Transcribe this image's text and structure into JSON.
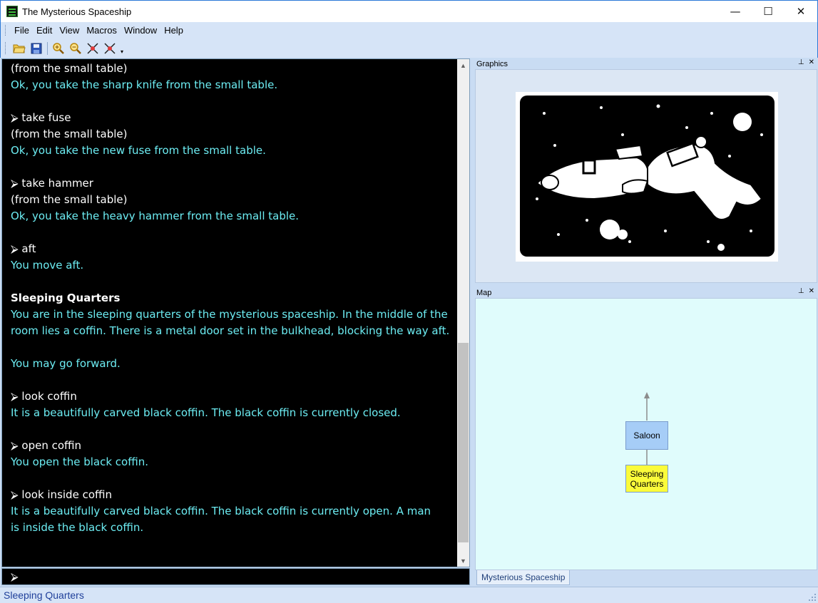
{
  "window": {
    "title": "The Mysterious Spaceship",
    "minimize_glyph": "—",
    "maximize_glyph": "☐",
    "close_glyph": "✕"
  },
  "menu": {
    "items": [
      {
        "label": "File"
      },
      {
        "label": "Edit"
      },
      {
        "label": "View"
      },
      {
        "label": "Macros"
      },
      {
        "label": "Window"
      },
      {
        "label": "Help"
      }
    ]
  },
  "toolbar": {
    "icons": [
      "open-folder-icon",
      "save-disk-icon",
      "zoom-in-icon",
      "zoom-out-icon",
      "restore-icon",
      "stop-icon"
    ],
    "more_glyph": "▾"
  },
  "transcript": {
    "lines": [
      {
        "style": "white",
        "text": "(from the small table)"
      },
      {
        "style": "cyan",
        "text": "Ok, you take the sharp knife from the small table."
      },
      {
        "style": "blank",
        "text": ""
      },
      {
        "style": "white",
        "text": "⮚ take fuse"
      },
      {
        "style": "white",
        "text": "(from the small table)"
      },
      {
        "style": "cyan",
        "text": "Ok, you take the new fuse from the small table."
      },
      {
        "style": "blank",
        "text": ""
      },
      {
        "style": "white",
        "text": "⮚ take hammer"
      },
      {
        "style": "white",
        "text": "(from the small table)"
      },
      {
        "style": "cyan",
        "text": "Ok, you take the heavy hammer from the small table."
      },
      {
        "style": "blank",
        "text": ""
      },
      {
        "style": "white",
        "text": "⮚ aft"
      },
      {
        "style": "cyan",
        "text": "You move aft."
      },
      {
        "style": "blank",
        "text": ""
      },
      {
        "style": "bold",
        "text": "Sleeping Quarters"
      },
      {
        "style": "cyan",
        "text": "You are in the sleeping quarters of the mysterious spaceship. In the middle of the"
      },
      {
        "style": "cyan",
        "text": "room lies a coffin. There is a metal door set in the bulkhead, blocking the way aft."
      },
      {
        "style": "blank",
        "text": ""
      },
      {
        "style": "cyan",
        "text": "You may go forward."
      },
      {
        "style": "blank",
        "text": ""
      },
      {
        "style": "white",
        "text": "⮚ look coffin"
      },
      {
        "style": "cyan",
        "text": "It is a beautifully carved black coffin.  The black coffin is currently closed."
      },
      {
        "style": "blank",
        "text": ""
      },
      {
        "style": "white",
        "text": "⮚ open coffin"
      },
      {
        "style": "cyan",
        "text": "You open the black coffin."
      },
      {
        "style": "blank",
        "text": ""
      },
      {
        "style": "white",
        "text": "⮚ look inside coffin"
      },
      {
        "style": "cyan",
        "text": "It is a beautifully carved black coffin.  The black coffin is currently open.  A man"
      },
      {
        "style": "cyan",
        "text": "is inside the black coffin."
      }
    ]
  },
  "command": {
    "prompt": "⮚",
    "value": ""
  },
  "graphics_panel": {
    "title": "Graphics",
    "pin_glyph": "⊥",
    "close_glyph": "✕"
  },
  "map_panel": {
    "title": "Map",
    "pin_glyph": "⊥",
    "close_glyph": "✕",
    "rooms": [
      {
        "name": "Saloon",
        "current": false
      },
      {
        "name": "Sleeping Quarters",
        "current": true
      }
    ],
    "tab": "Mysterious Spaceship"
  },
  "colors": {
    "transcript_bg": "#000000",
    "output_text": "#6cecf2",
    "input_text": "#ffffff",
    "map_bg": "#e0fcfc",
    "room_normal": "#a6cdf7",
    "room_current": "#fbfb3a",
    "status_text": "#1f3f9a"
  },
  "status": {
    "location": "Sleeping Quarters"
  }
}
